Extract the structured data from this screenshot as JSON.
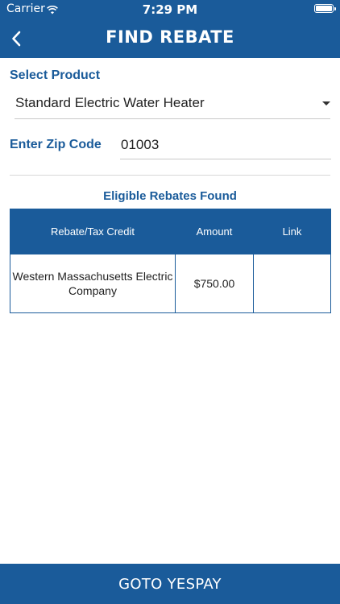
{
  "status_bar": {
    "carrier": "Carrier",
    "time": "7:29 PM",
    "icons": [
      "wifi-icon",
      "battery-icon"
    ]
  },
  "nav": {
    "back_icon": "chevron-left-icon",
    "title": "FIND REBATE"
  },
  "form": {
    "product_label": "Select Product",
    "product_value": "Standard Electric Water Heater",
    "product_caret_icon": "caret-down-icon",
    "zip_label": "Enter Zip Code",
    "zip_value": "01003"
  },
  "results": {
    "heading": "Eligible Rebates Found",
    "columns": [
      "Rebate/Tax Credit",
      "Amount",
      "Link"
    ],
    "rows": [
      {
        "rebate": "Western Massachusetts Electric Company",
        "amount": "$750.00",
        "link": ""
      }
    ]
  },
  "footer": {
    "button_label": "GOTO YESPAY"
  },
  "colors": {
    "primary": "#1a5b9a",
    "text": "#222222",
    "divider": "#c8c8c8"
  }
}
